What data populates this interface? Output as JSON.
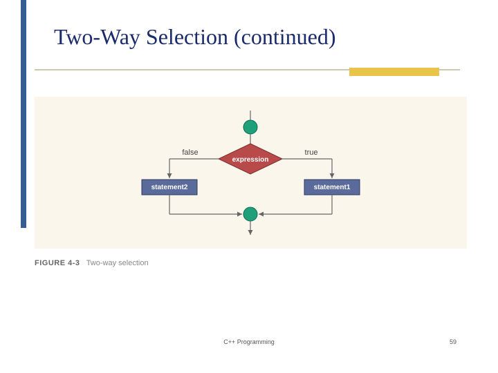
{
  "slide": {
    "title": "Two-Way Selection (continued)"
  },
  "diagram": {
    "expression_label": "expression",
    "false_label": "false",
    "true_label": "true",
    "statement_left": "statement2",
    "statement_right": "statement1"
  },
  "caption": {
    "figure_label": "FIGURE 4-3",
    "figure_text": "Two-way selection"
  },
  "footer": {
    "course": "C++ Programming",
    "page_number": "59"
  },
  "colors": {
    "sidebar": "#355e93",
    "accent": "#e8c54a",
    "diagram_bg": "#faf6eb",
    "node_green": "#1fa07a",
    "diamond_fill": "#b84a4a",
    "box_fill": "#5a6a9a"
  }
}
